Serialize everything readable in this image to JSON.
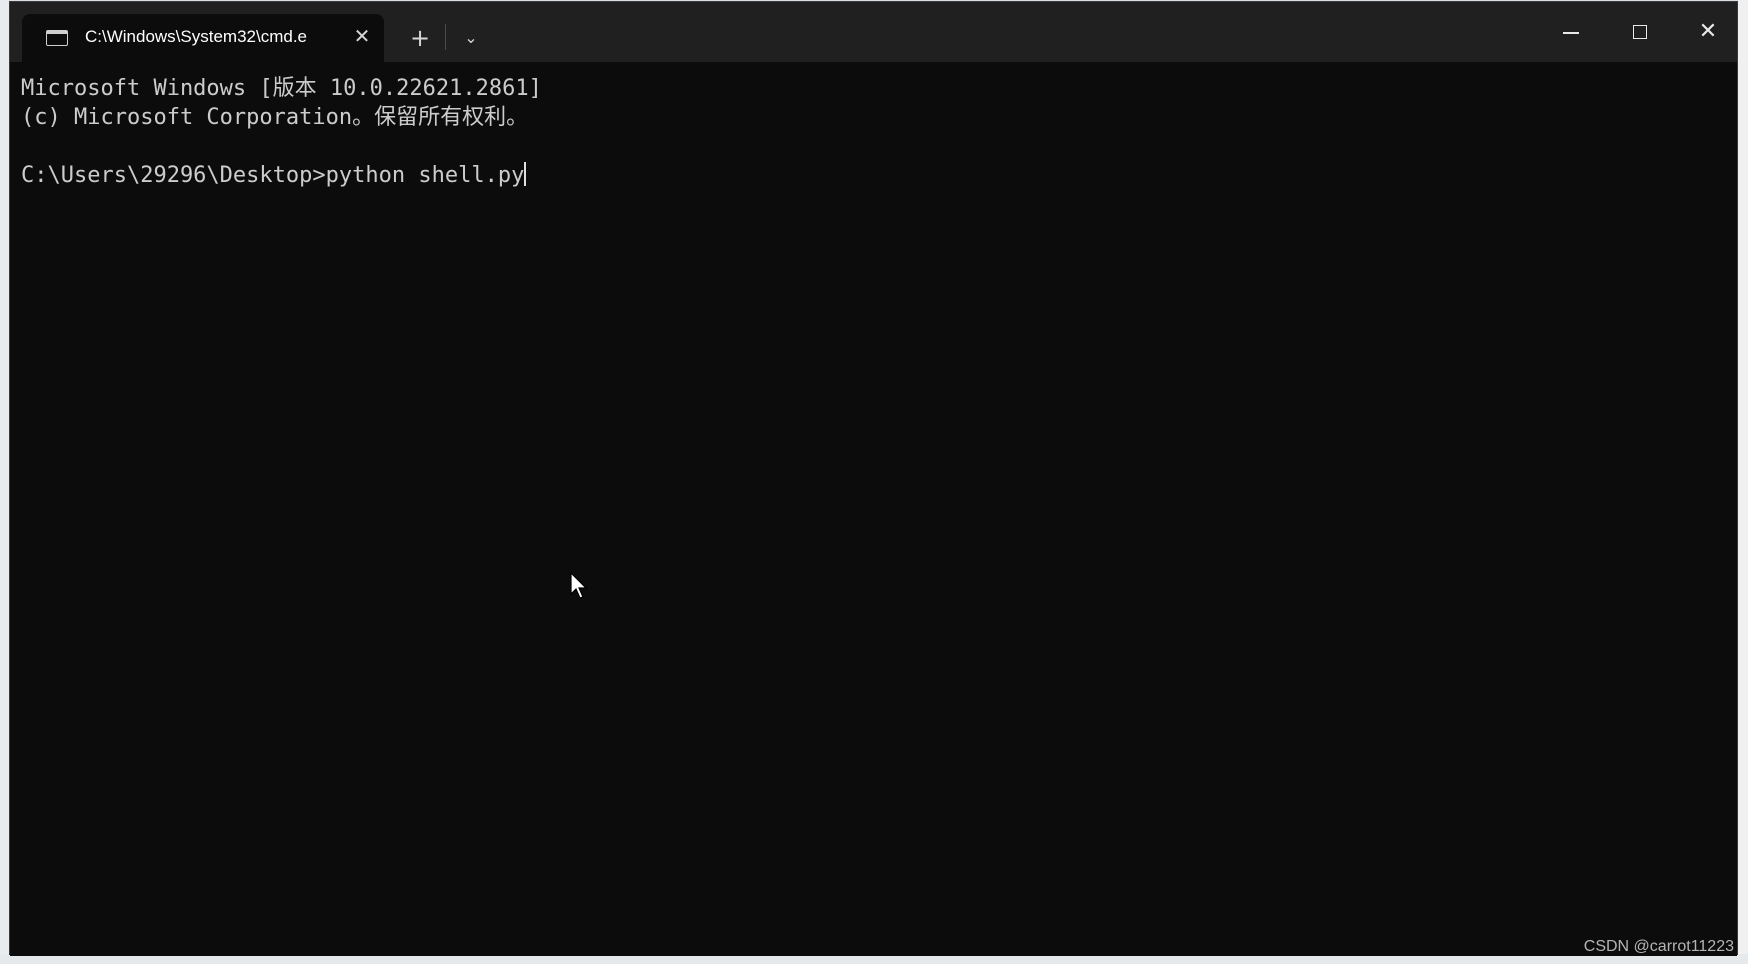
{
  "window": {
    "tab_title": "C:\\Windows\\System32\\cmd.e",
    "tab_icon": "terminal-icon",
    "close_tab_glyph": "✕",
    "new_tab_glyph": "+",
    "dropdown_glyph": "⌄",
    "close_window_glyph": "✕"
  },
  "console": {
    "lines": [
      "Microsoft Windows [版本 10.0.22621.2861]",
      "(c) Microsoft Corporation。保留所有权利。",
      "",
      "C:\\Users\\29296\\Desktop>python shell.py"
    ]
  },
  "watermark": "CSDN @carrot11223",
  "colors": {
    "console_bg": "#0c0c0c",
    "titlebar_bg": "#202020",
    "console_text": "#cccccc"
  }
}
